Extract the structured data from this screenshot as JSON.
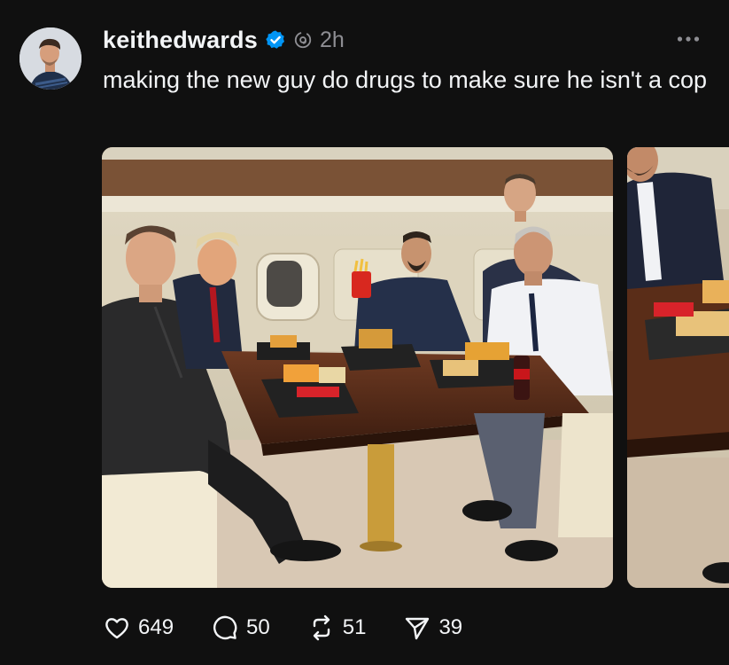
{
  "post": {
    "username": "keithedwards",
    "timestamp": "2h",
    "caption": "making the new guy do drugs to make sure he isn't a cop"
  },
  "icons": {
    "verified": "verified-badge-icon",
    "threads": "threads-logo-icon",
    "more": "more-options-icon",
    "like": "heart-icon",
    "reply": "comment-icon",
    "repost": "repost-icon",
    "share": "send-icon"
  },
  "actions": {
    "likes": "649",
    "replies": "50",
    "reposts": "51",
    "shares": "39"
  },
  "colors": {
    "background": "#101010",
    "text": "#f3f5f7",
    "secondary_text": "#8e8e93",
    "verified_blue": "#0095f6"
  }
}
